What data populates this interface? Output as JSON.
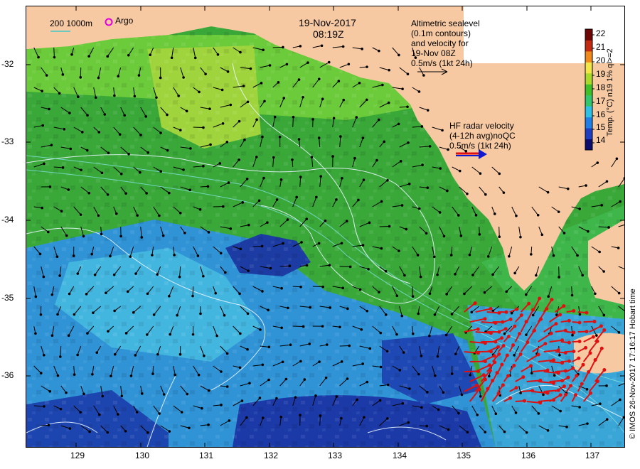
{
  "date": "19-Nov-2017",
  "time": "08:19Z",
  "legend": {
    "bathymetry_label": "200  1000m",
    "argo_label": "Argo"
  },
  "altimetry_note": [
    "Altimetric sealevel",
    "(0.1m contours)",
    "and velocity for",
    "19-Nov 08Z",
    "0.5m/s (1kt 24h)"
  ],
  "hf_radar_note": [
    "HF radar velocity",
    "(4-12h avg)noQC",
    "0.5m/s (1kt 24h)"
  ],
  "colorbar": {
    "title": "Temp. (°C) n19 1% ql>=2",
    "ticks": [
      "22",
      "21",
      "20",
      "19",
      "18",
      "17",
      "16",
      "15",
      "14"
    ],
    "min": 13.5,
    "max": 22.5,
    "colors": [
      "#0b0c6e",
      "#1e3ec0",
      "#1f7fe6",
      "#2fc0e6",
      "#34c66e",
      "#3fbf2a",
      "#a9d92a",
      "#f1e64a",
      "#f08a1c",
      "#c22a12",
      "#6e0606"
    ]
  },
  "axes": {
    "lon_ticks": [
      "129",
      "130",
      "131",
      "132",
      "133",
      "134",
      "135",
      "136",
      "137"
    ],
    "lat_ticks": [
      "-32",
      "-33",
      "-34",
      "-35",
      "-36"
    ]
  },
  "credit": "© IMOS 26-Nov-2017 17:16:17 Hobart time",
  "colors": {
    "land": "#f7c9a3",
    "sea_green": "#3caa36",
    "sea_light": "#8fd23a",
    "sea_blue": "#2a7fd8",
    "sea_deep": "#1c2fa8",
    "vector": "#000000",
    "hf_vector": "#e01010",
    "contour": "#e8f4ff",
    "bathy": "#7fe0e0",
    "argo": "#e000e0"
  }
}
